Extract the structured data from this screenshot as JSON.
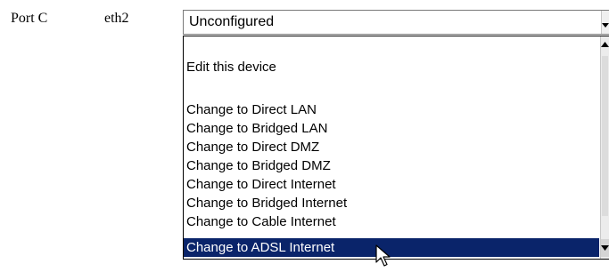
{
  "row": {
    "port_label": "Port C",
    "interface_label": "eth2"
  },
  "select": {
    "current_value": "Unconfigured"
  },
  "dropdown": {
    "options": [
      "Edit this device",
      "Change to Direct LAN",
      "Change to Bridged LAN",
      "Change to Direct DMZ",
      "Change to Bridged DMZ",
      "Change to Direct Internet",
      "Change to Bridged Internet",
      "Change to Cable Internet",
      "Change to ADSL Internet"
    ],
    "highlighted_option": "Change to ADSL Internet"
  },
  "colors": {
    "selection_background": "#0a246a",
    "selection_text": "#ffffff"
  },
  "icons": {
    "select_arrow": "chevron-down-icon",
    "scroll_up": "scroll-up-arrow-icon",
    "scroll_down": "scroll-down-arrow-icon",
    "cursor": "mouse-pointer-icon"
  }
}
